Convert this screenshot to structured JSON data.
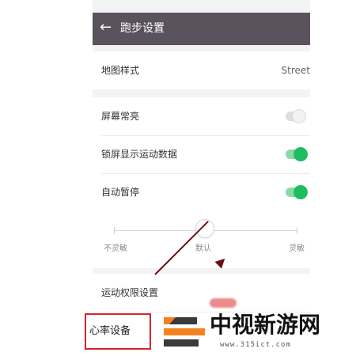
{
  "header": {
    "back_icon": "back-arrow-icon",
    "title": "跑步设置"
  },
  "settings": {
    "map_style": {
      "label": "地图样式",
      "value": "Street"
    },
    "screen_on": {
      "label": "屏幕常亮",
      "enabled": false
    },
    "lock_screen_data": {
      "label": "锁屏显示运动数据",
      "enabled": true
    },
    "auto_pause": {
      "label": "自动暂停",
      "enabled": true
    },
    "sensitivity": {
      "left_label": "不灵敏",
      "center_label": "默认",
      "right_label": "灵敏",
      "level": 0.5
    },
    "motion_permission": {
      "label": "运动权限设置"
    },
    "heart_rate_device": {
      "label": "心率设备"
    }
  },
  "watermark": {
    "title": "中视新游网",
    "url": "www.315ict.com"
  },
  "colors": {
    "topbar": "#5a525c",
    "toggle_on": "#1ebd62",
    "toggle_on_track": "#8dd8a8",
    "annotation": "#d9232f",
    "logo_orange": "#f58220",
    "logo_dark": "#3a3a3a"
  }
}
